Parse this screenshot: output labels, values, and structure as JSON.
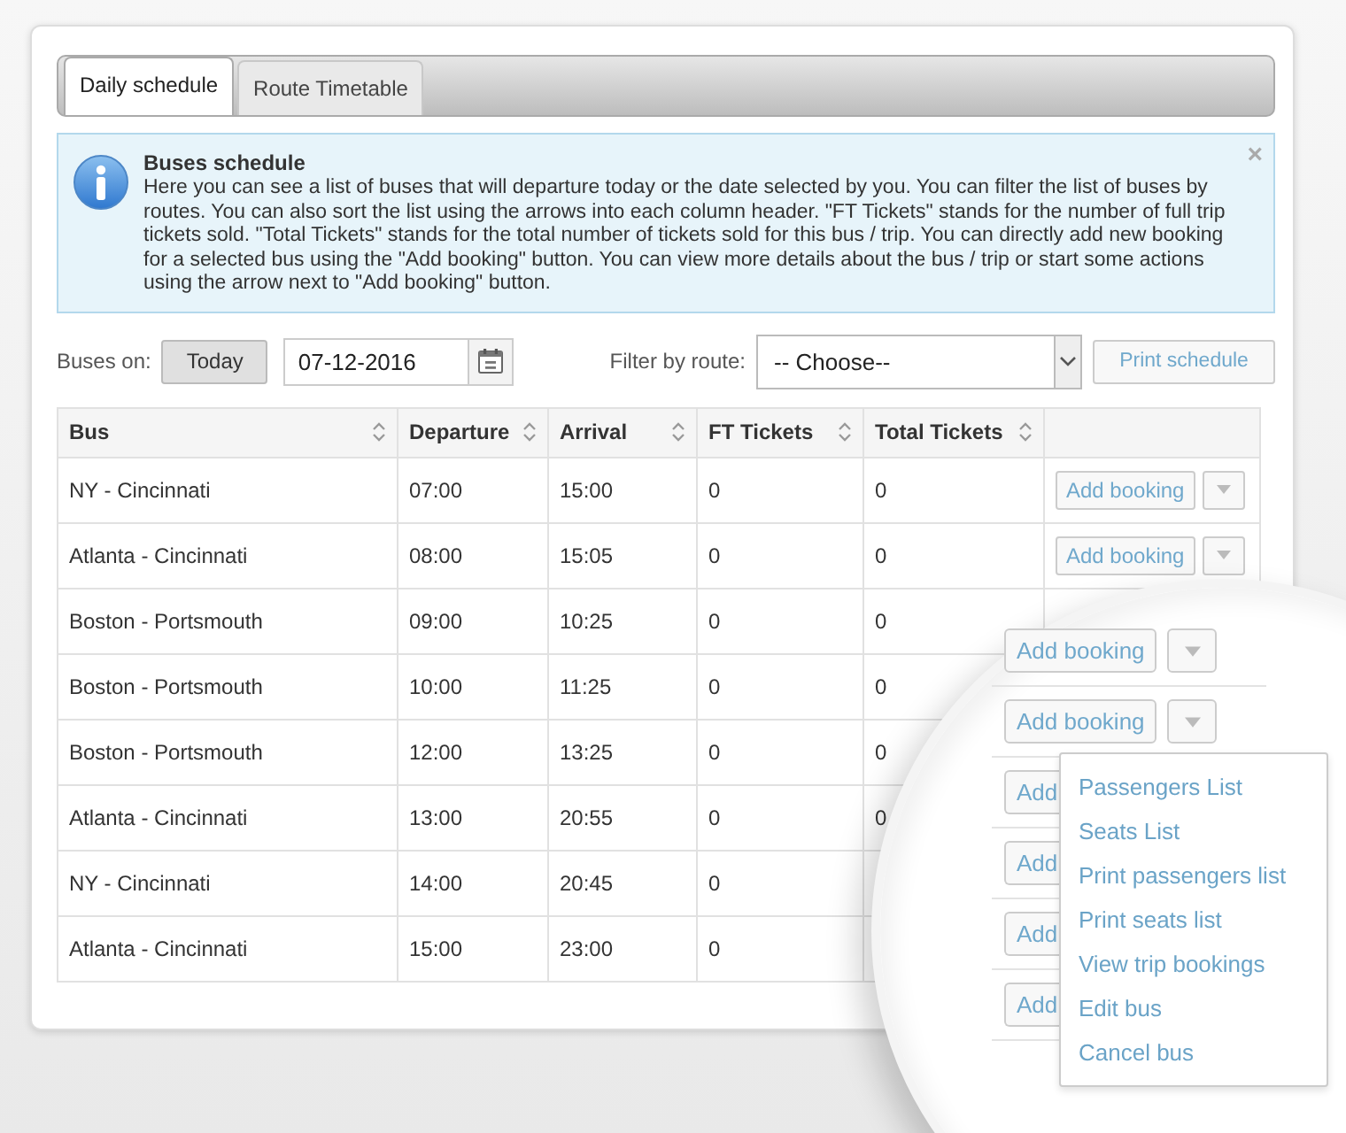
{
  "tabs": [
    {
      "label": "Daily schedule",
      "selected": true
    },
    {
      "label": "Route Timetable",
      "selected": false
    }
  ],
  "info": {
    "title": "Buses schedule",
    "close": "×",
    "text": "Here you can see a list of buses that will departure today or the date selected by you. You can filter the list of buses by routes. You can also sort the list using the arrows into each column header. \"FT Tickets\" stands for the number of full trip tickets sold. \"Total Tickets\" stands for the total number of tickets sold for this bus / trip. You can directly add new booking for a selected bus using the \"Add booking\" button. You can view more details about the bus / trip or start some actions using the arrow next to \"Add booking\" button."
  },
  "filters": {
    "buses_on_label": "Buses on:",
    "today_button": "Today",
    "date": "07-12-2016",
    "route_label": "Filter by route:",
    "route_select": "-- Choose--",
    "print_button": "Print schedule"
  },
  "table": {
    "columns": [
      "Bus",
      "Departure",
      "Arrival",
      "FT Tickets",
      "Total Tickets"
    ],
    "rows": [
      {
        "bus": "NY - Cincinnati",
        "departure": "07:00",
        "arrival": "15:00",
        "ft_tickets": "0",
        "total_tickets": "0",
        "action": "Add booking"
      },
      {
        "bus": "Atlanta - Cincinnati",
        "departure": "08:00",
        "arrival": "15:05",
        "ft_tickets": "0",
        "total_tickets": "0",
        "action": "Add booking"
      },
      {
        "bus": "Boston - Portsmouth",
        "departure": "09:00",
        "arrival": "10:25",
        "ft_tickets": "0",
        "total_tickets": "0"
      },
      {
        "bus": "Boston - Portsmouth",
        "departure": "10:00",
        "arrival": "11:25",
        "ft_tickets": "0",
        "total_tickets": "0"
      },
      {
        "bus": "Boston - Portsmouth",
        "departure": "12:00",
        "arrival": "13:25",
        "ft_tickets": "0",
        "total_tickets": "0"
      },
      {
        "bus": "Atlanta - Cincinnati",
        "departure": "13:00",
        "arrival": "20:55",
        "ft_tickets": "0",
        "total_tickets": "0"
      },
      {
        "bus": "NY - Cincinnati",
        "departure": "14:00",
        "arrival": "20:45",
        "ft_tickets": "0"
      },
      {
        "bus": "Atlanta - Cincinnati",
        "departure": "15:00",
        "arrival": "23:00",
        "ft_tickets": "0"
      }
    ]
  },
  "magnifier": {
    "buttons": [
      {
        "label": "Add booking",
        "caret": true
      },
      {
        "label": "Add booking",
        "caret": true
      },
      {
        "label": "Add"
      },
      {
        "label": "Add"
      },
      {
        "label": "Add"
      },
      {
        "label": "Add"
      }
    ],
    "menu": [
      "Passengers List",
      "Seats List",
      "Print passengers list",
      "Print seats list",
      "View trip bookings",
      "Edit bus",
      "Cancel bus"
    ]
  }
}
